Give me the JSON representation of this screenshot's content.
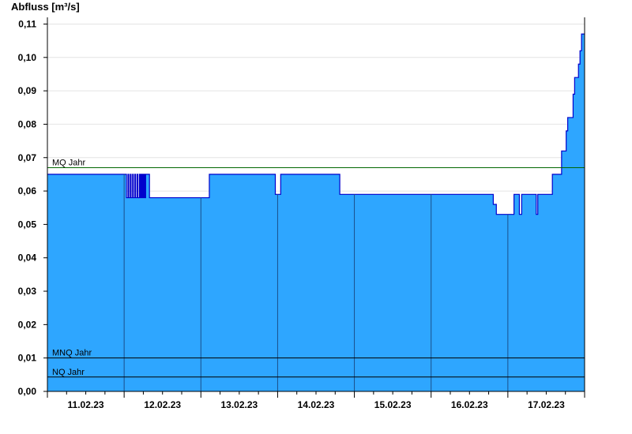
{
  "chart_data": {
    "type": "area",
    "title": "",
    "ylabel": "Abfluss [m³/s]",
    "xlabel": "",
    "ylim": [
      0,
      0.112
    ],
    "x_ticks": [
      "11.02.23",
      "12.02.23",
      "13.02.23",
      "14.02.23",
      "15.02.23",
      "16.02.23",
      "17.02.23"
    ],
    "y_ticks": [
      "0,00",
      "0,01",
      "0,02",
      "0,03",
      "0,04",
      "0,05",
      "0,06",
      "0,07",
      "0,08",
      "0,09",
      "0,10",
      "0,11"
    ],
    "x_range_days": [
      -0.5,
      6.5
    ],
    "fill_color": "#2ea6ff",
    "line_color": "#0000cc",
    "series": [
      {
        "x": [
          -0.5,
          0.52,
          0.53,
          0.55,
          0.56,
          0.58,
          0.59,
          0.61,
          0.62,
          0.64,
          0.65,
          0.67,
          0.68,
          0.7,
          0.71,
          0.72,
          0.73,
          0.74,
          0.75,
          0.76,
          0.77,
          0.78,
          0.83,
          0.84,
          1.6,
          1.61,
          2.45,
          2.47,
          2.52,
          2.54,
          2.8,
          3.3,
          3.31,
          4.3,
          4.31,
          5.3,
          5.31,
          5.34,
          5.35,
          5.57,
          5.58,
          5.64,
          5.65,
          5.67,
          5.68,
          5.86,
          5.87,
          5.88,
          5.89,
          5.9,
          6.0,
          6.08,
          6.1,
          6.2,
          6.22,
          6.26,
          6.28,
          6.35,
          6.37,
          6.42,
          6.44,
          6.46,
          6.47,
          6.5
        ],
        "y": [
          0.065,
          0.065,
          0.058,
          0.065,
          0.058,
          0.065,
          0.058,
          0.065,
          0.058,
          0.065,
          0.058,
          0.065,
          0.058,
          0.065,
          0.058,
          0.065,
          0.058,
          0.065,
          0.058,
          0.065,
          0.058,
          0.065,
          0.058,
          0.058,
          0.058,
          0.065,
          0.065,
          0.059,
          0.059,
          0.065,
          0.065,
          0.065,
          0.059,
          0.059,
          0.059,
          0.059,
          0.056,
          0.056,
          0.053,
          0.053,
          0.059,
          0.059,
          0.053,
          0.053,
          0.059,
          0.059,
          0.053,
          0.053,
          0.059,
          0.059,
          0.059,
          0.065,
          0.065,
          0.072,
          0.072,
          0.078,
          0.082,
          0.089,
          0.094,
          0.098,
          0.102,
          0.107,
          0.107,
          0.107
        ]
      }
    ],
    "reference_lines": [
      {
        "label": "MQ Jahr",
        "value": 0.067,
        "color": "#006600"
      },
      {
        "label": "MNQ Jahr",
        "value": 0.01,
        "color": "#000000"
      },
      {
        "label": "NQ Jahr",
        "value": 0.0043,
        "color": "#000000"
      }
    ],
    "grid": true
  }
}
